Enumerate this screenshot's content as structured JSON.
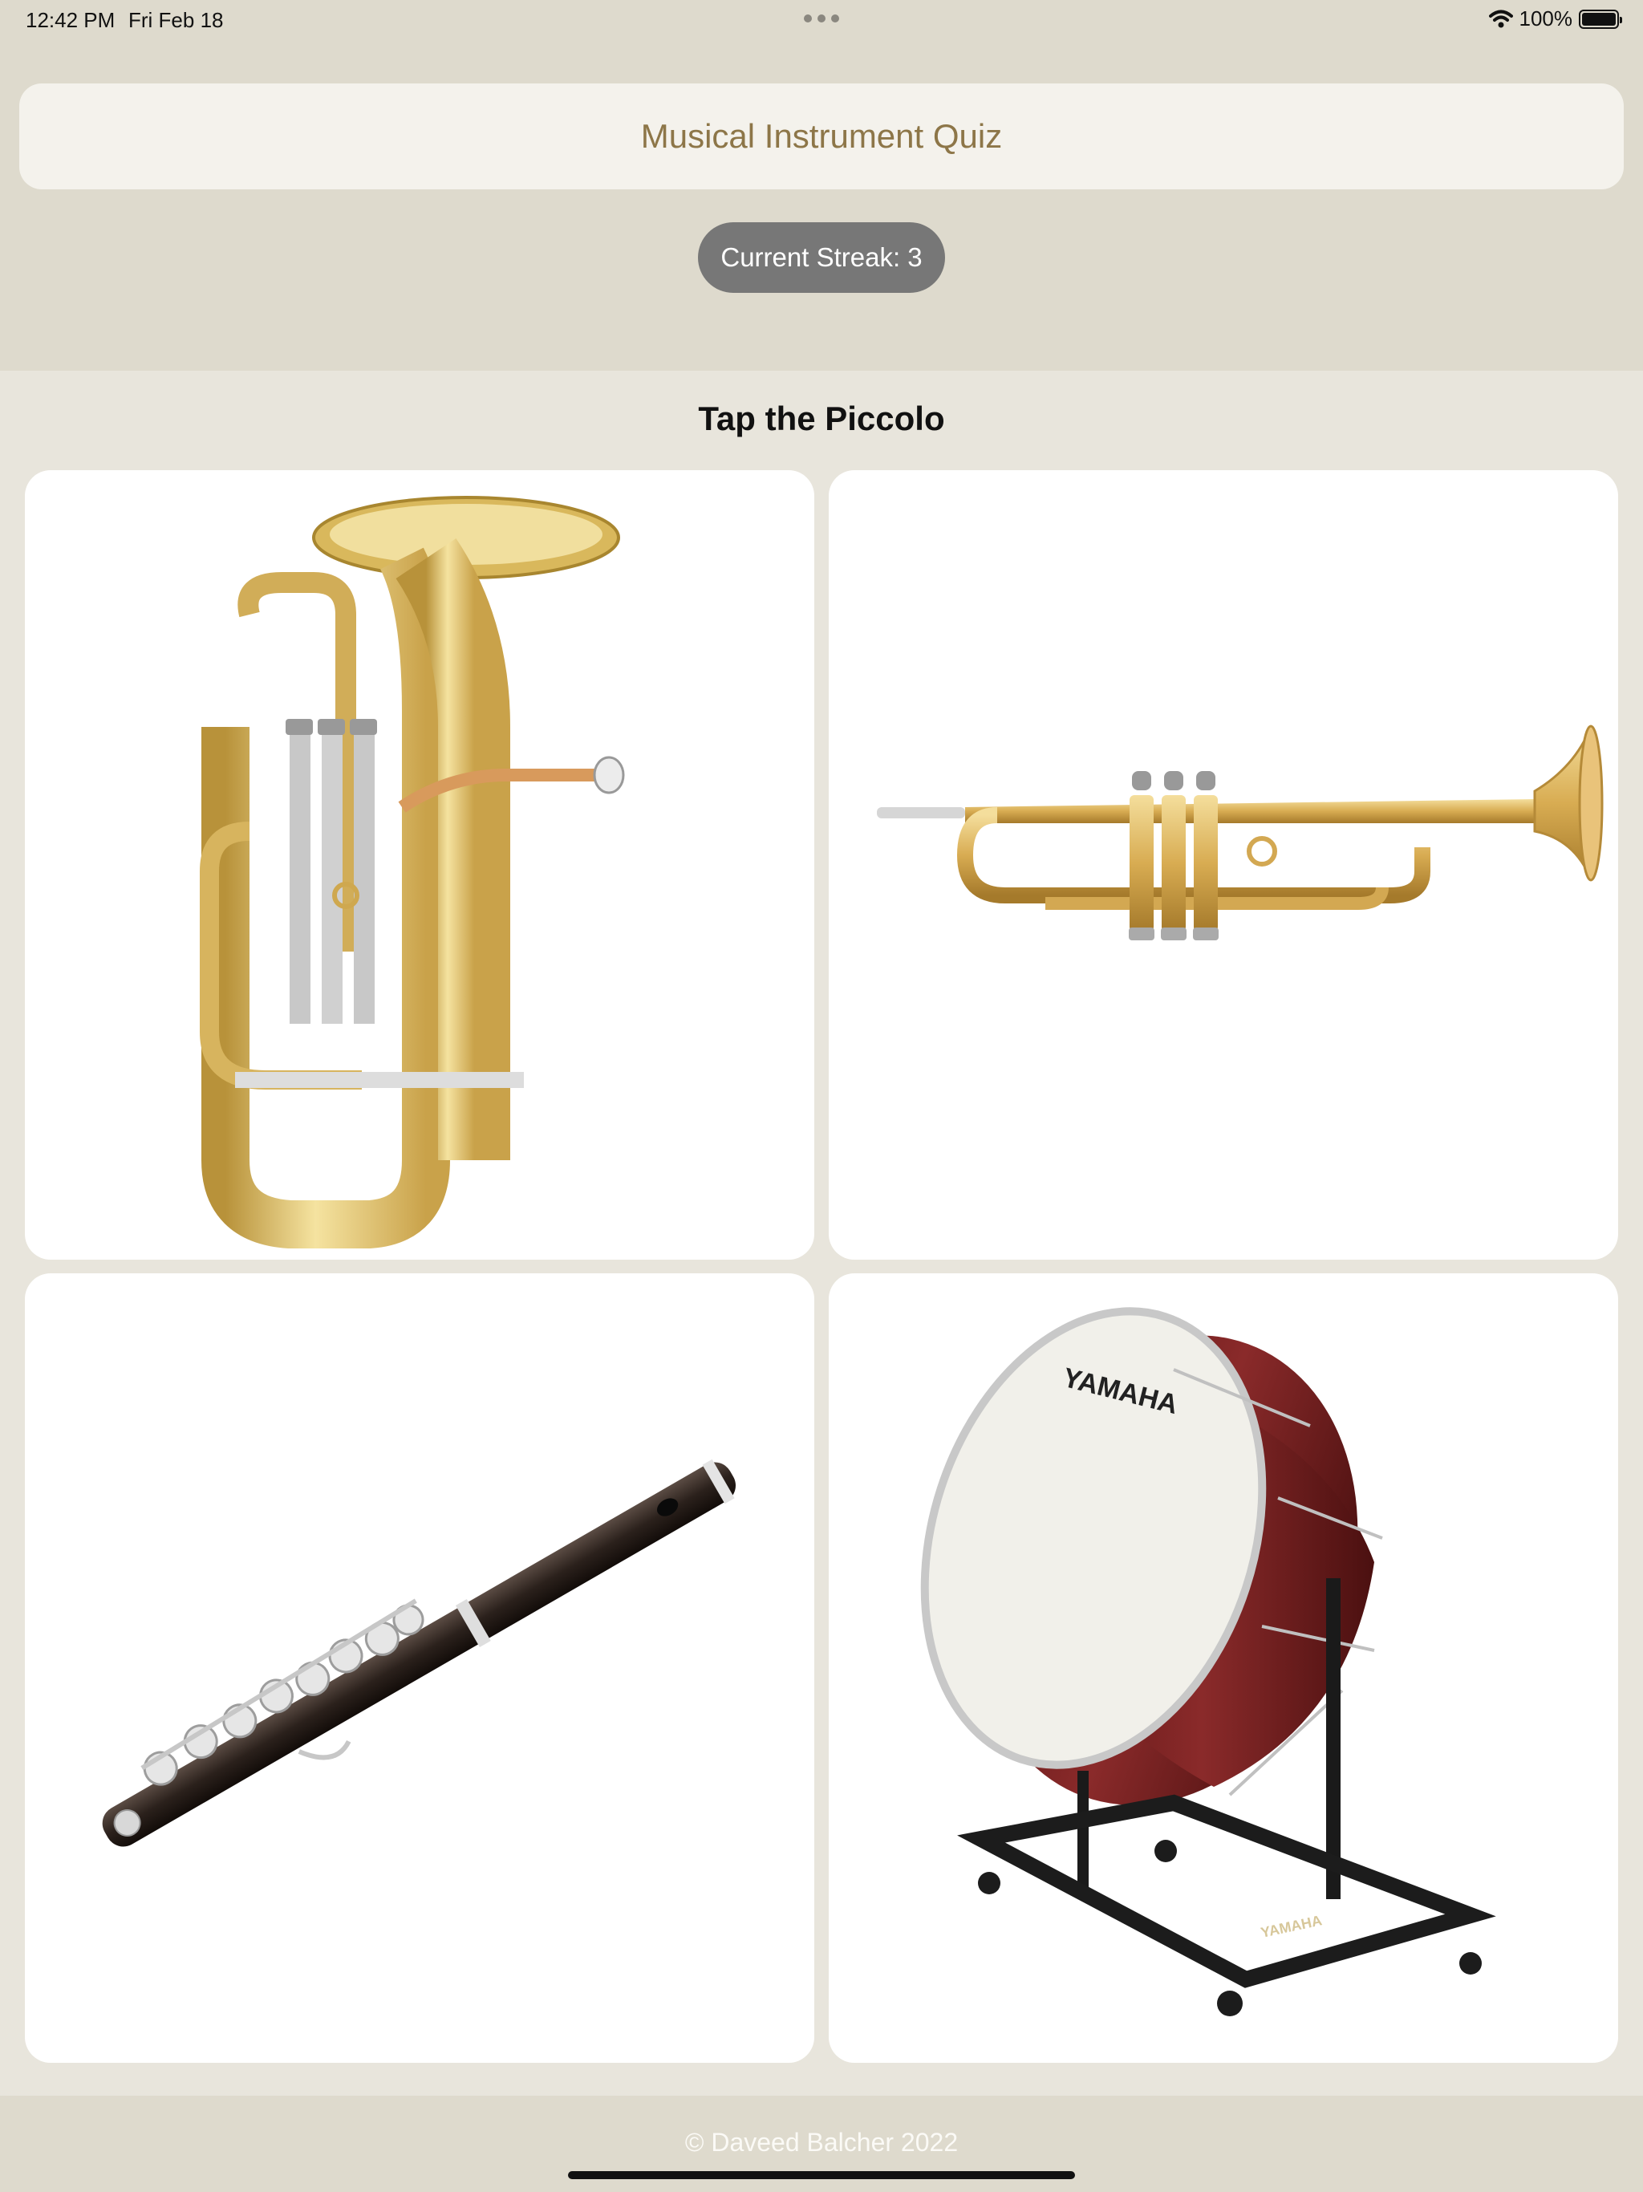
{
  "status_bar": {
    "time": "12:42 PM",
    "date": "Fri Feb 18",
    "battery": "100%",
    "battery_level": 1.0
  },
  "header": {
    "title": "Musical Instrument Quiz",
    "streak": "Current Streak: 3"
  },
  "quiz": {
    "prompt": "Tap the Piccolo",
    "options": [
      {
        "instrument_icon": "euphonium-icon"
      },
      {
        "instrument_icon": "trumpet-icon"
      },
      {
        "instrument_icon": "piccolo-icon"
      },
      {
        "instrument_icon": "bass-drum-icon"
      }
    ],
    "drum_brand": "YAMAHA",
    "stand_brand": "YAMAHA"
  },
  "footer": {
    "copyright": "© Daveed Balcher 2022"
  },
  "colors": {
    "title_text": "#8d7648",
    "streak_bg": "#777777",
    "brass": "#d8b457",
    "drum_shell": "#6b1d1d"
  }
}
